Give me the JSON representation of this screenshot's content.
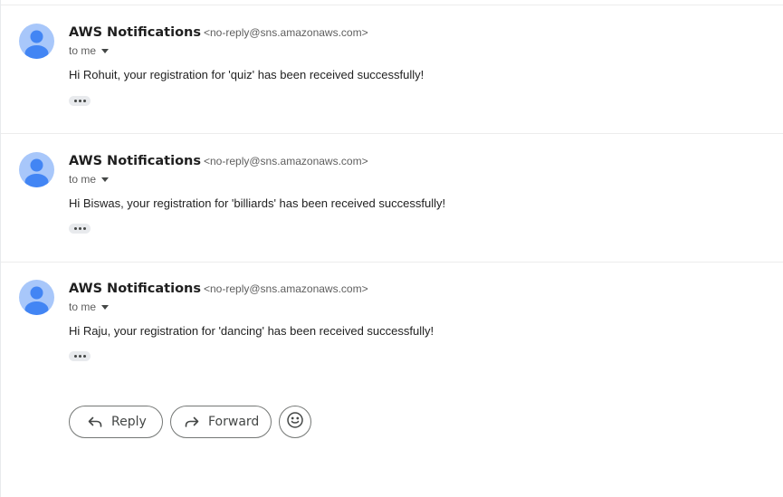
{
  "messages": [
    {
      "sender_name": "AWS Notifications",
      "sender_email": "<no-reply@sns.amazonaws.com>",
      "recipient": "to me",
      "body": "Hi Rohuit, your registration for 'quiz' has been received successfully!",
      "avatar_icon": "person-avatar-icon"
    },
    {
      "sender_name": "AWS Notifications",
      "sender_email": "<no-reply@sns.amazonaws.com>",
      "recipient": "to me",
      "body": "Hi Biswas, your registration for 'billiards' has been received successfully!",
      "avatar_icon": "person-avatar-icon"
    },
    {
      "sender_name": "AWS Notifications",
      "sender_email": "<no-reply@sns.amazonaws.com>",
      "recipient": "to me",
      "body": "Hi Raju, your registration for 'dancing' has been received successfully!",
      "avatar_icon": "person-avatar-icon"
    }
  ],
  "actions": {
    "reply_label": "Reply",
    "forward_label": "Forward",
    "reply_icon": "reply-arrow-icon",
    "forward_icon": "forward-arrow-icon",
    "emoji_icon": "smiley-icon"
  },
  "colors": {
    "avatar_bg": "#a8c7fa",
    "avatar_fg": "#4285f4",
    "divider": "#ececec"
  }
}
